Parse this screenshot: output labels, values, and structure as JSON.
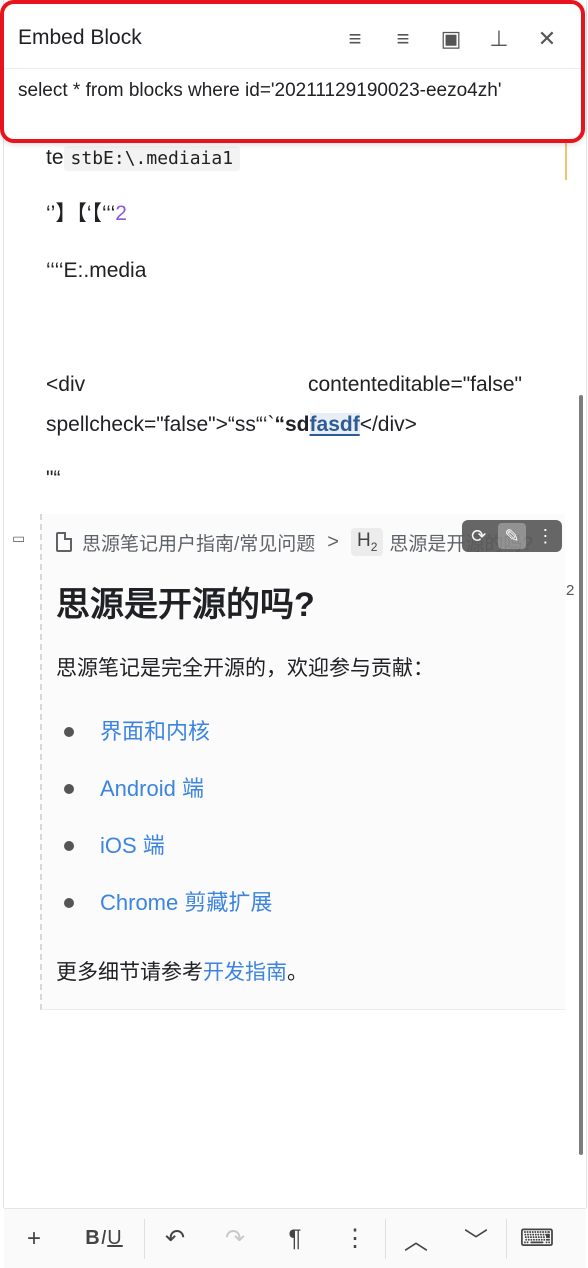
{
  "popup": {
    "title": "Embed Block",
    "query": "select * from blocks where id='20211129190023-eezo4zh'",
    "tools": [
      {
        "name": "collapse-list-icon",
        "glyph": "≡"
      },
      {
        "name": "outdent-list-icon",
        "glyph": "≡"
      },
      {
        "name": "image-icon",
        "glyph": "▣"
      },
      {
        "name": "pin-icon",
        "glyph": "⊥"
      },
      {
        "name": "close-icon",
        "glyph": "✕"
      }
    ]
  },
  "editor": {
    "line1_prefix": "te",
    "line1_code": "stbE:\\.mediaia1",
    "line2_text": "‘’】【‘【‘‘‘",
    "line2_num": "2",
    "line3": "‘‘‘‘E:.media",
    "line4a_left": "<div",
    "line4a_right": "contenteditable=\"false\"",
    "line4b_prefix": "spellcheck=\"false\">“ss“‘`",
    "line4b_bold1": "“sd",
    "line4b_bold2": "fasdf",
    "line4b_suffix": "</div>",
    "line5": "\"“"
  },
  "embed": {
    "breadcrumb_path": "思源笔记用户指南/常见问题",
    "breadcrumb_sep": ">",
    "breadcrumb_h2": "H",
    "breadcrumb_h2_sub": "2",
    "breadcrumb_heading": "思源是开源的吗?",
    "title": "思源是开源的吗?",
    "para": "思源笔记是完全开源的，欢迎参与贡献：",
    "list": [
      "界面和内核",
      "Android 端",
      "iOS 端",
      "Chrome 剪藏扩展"
    ],
    "footer_prefix": "更多细节请参考",
    "footer_link": "开发指南",
    "footer_suffix": "。",
    "side_number": "2"
  },
  "toolbar": {
    "add": "+",
    "biu_b": "B",
    "biu_i": "I",
    "biu_u": "U",
    "undo": "↶",
    "redo": "↷",
    "paragraph": "¶",
    "more": "⋮",
    "up": "︿",
    "down": "﹀",
    "keyboard": "⌨"
  }
}
